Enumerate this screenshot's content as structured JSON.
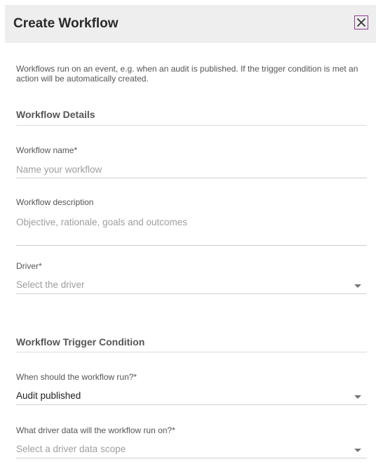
{
  "dialog": {
    "title": "Create Workflow",
    "close_icon": "close-icon"
  },
  "intro": {
    "text": "Workflows run on an event, e.g. when an audit is published. If the trigger condition is met an action will be automatically created."
  },
  "workflow_details": {
    "section_title": "Workflow Details",
    "name": {
      "label": "Workflow name*",
      "placeholder": "Name your workflow",
      "value": ""
    },
    "description": {
      "label": "Workflow description",
      "placeholder": "Objective, rationale, goals and outcomes",
      "value": ""
    },
    "driver": {
      "label": "Driver*",
      "placeholder": "Select the driver",
      "icon": "chevron-down-icon"
    }
  },
  "trigger_condition": {
    "section_title": "Workflow Trigger Condition",
    "when_run": {
      "label": "When should the workflow run?*",
      "value": "Audit published",
      "icon": "chevron-down-icon"
    },
    "driver_data": {
      "label": "What driver data will the workflow run on?*",
      "placeholder": "Select a driver data scope",
      "icon": "chevron-down-icon"
    }
  },
  "colors": {
    "header_bg": "#eeeeee",
    "close_border": "#8e3a8e",
    "placeholder": "#9e9e9e",
    "label": "#555555"
  }
}
